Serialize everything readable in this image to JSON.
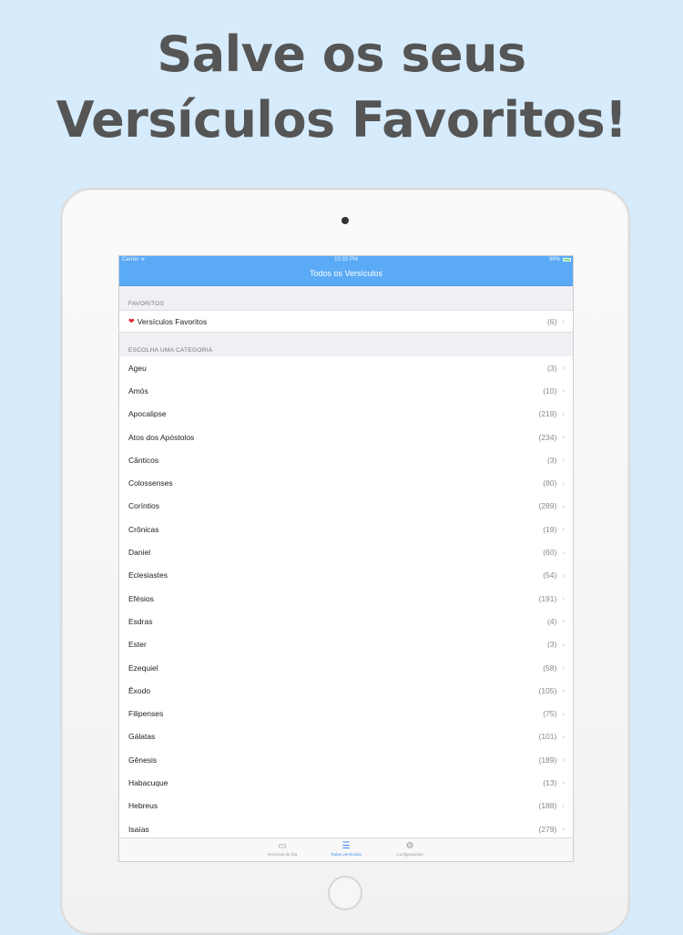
{
  "headline": {
    "line1": "Salve os seus",
    "line2": "Versículos Favoritos!"
  },
  "colors": {
    "background": "#d6ebfb",
    "accent": "#5aaaf6",
    "heart": "#e0242f"
  },
  "statusbar": {
    "carrier": "Carrier ᯤ",
    "time": "10:32 PM",
    "battery": "96%"
  },
  "navbar": {
    "title": "Todos os Versículos"
  },
  "favorites": {
    "header": "FAVORITOS",
    "icon": "heart-icon",
    "label": "Versículos Favoritos",
    "count": "(6)"
  },
  "categories": {
    "header": "ESCOLHA UMA CATEGORIA",
    "items": [
      {
        "label": "Ageu",
        "count": "(3)"
      },
      {
        "label": "Amós",
        "count": "(10)"
      },
      {
        "label": "Apocalipse",
        "count": "(219)"
      },
      {
        "label": "Atos dos Apóstolos",
        "count": "(234)"
      },
      {
        "label": "Cânticos",
        "count": "(3)"
      },
      {
        "label": "Colossenses",
        "count": "(80)"
      },
      {
        "label": "Coríntios",
        "count": "(289)"
      },
      {
        "label": "Crônicas",
        "count": "(19)"
      },
      {
        "label": "Daniel",
        "count": "(60)"
      },
      {
        "label": "Eclesiastes",
        "count": "(54)"
      },
      {
        "label": "Efésios",
        "count": "(191)"
      },
      {
        "label": "Esdras",
        "count": "(4)"
      },
      {
        "label": "Ester",
        "count": "(3)"
      },
      {
        "label": "Ezequiel",
        "count": "(58)"
      },
      {
        "label": "Êxodo",
        "count": "(105)"
      },
      {
        "label": "Filipenses",
        "count": "(75)"
      },
      {
        "label": "Gálatas",
        "count": "(101)"
      },
      {
        "label": "Gênesis",
        "count": "(189)"
      },
      {
        "label": "Habacuque",
        "count": "(13)"
      },
      {
        "label": "Hebreus",
        "count": "(188)"
      },
      {
        "label": "Isaías",
        "count": "(279)"
      }
    ]
  },
  "tabbar": {
    "items": [
      {
        "label": "Versículo do Dia",
        "icon": "book-icon"
      },
      {
        "label": "Todos versículos",
        "icon": "list-icon"
      },
      {
        "label": "Configurações",
        "icon": "gear-icon"
      }
    ]
  }
}
